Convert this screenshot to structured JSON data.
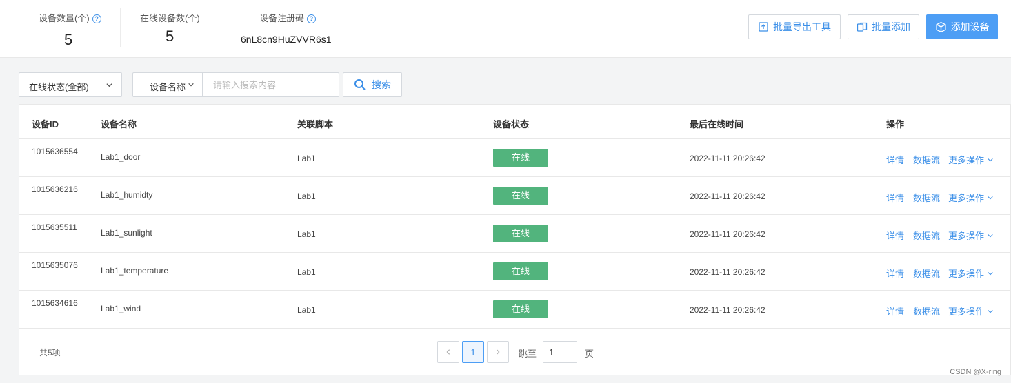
{
  "stats": {
    "device_count": {
      "label": "设备数量(个)",
      "value": "5"
    },
    "online_count": {
      "label": "在线设备数(个)",
      "value": "5"
    },
    "reg_code": {
      "label": "设备注册码",
      "value": "6nL8cn9HuZVVR6s1"
    }
  },
  "toolbar": {
    "export_label": "批量导出工具",
    "batch_add_label": "批量添加",
    "add_label": "添加设备"
  },
  "filters": {
    "status_select": "在线状态(全部)",
    "field_select": "设备名称",
    "search_placeholder": "请输入搜索内容",
    "search_label": "搜索"
  },
  "table": {
    "columns": [
      "设备ID",
      "设备名称",
      "关联脚本",
      "设备状态",
      "最后在线时间",
      "操作"
    ],
    "rows": [
      {
        "id": "1015636554",
        "name": "Lab1_door",
        "script": "Lab1",
        "status": "在线",
        "time": "2022-11-11 20:26:42"
      },
      {
        "id": "1015636216",
        "name": "Lab1_humidty",
        "script": "Lab1",
        "status": "在线",
        "time": "2022-11-11 20:26:42"
      },
      {
        "id": "1015635511",
        "name": "Lab1_sunlight",
        "script": "Lab1",
        "status": "在线",
        "time": "2022-11-11 20:26:42"
      },
      {
        "id": "1015635076",
        "name": "Lab1_temperature",
        "script": "Lab1",
        "status": "在线",
        "time": "2022-11-11 20:26:42"
      },
      {
        "id": "1015634616",
        "name": "Lab1_wind",
        "script": "Lab1",
        "status": "在线",
        "time": "2022-11-11 20:26:42"
      }
    ],
    "actions": {
      "detail": "详情",
      "stream": "数据流",
      "more": "更多操作"
    }
  },
  "pagination": {
    "total": "共5项",
    "current_page": "1",
    "jump_label": "跳至",
    "jump_value": "1",
    "page_suffix": "页"
  },
  "watermark": "CSDN @X-ring",
  "colors": {
    "accent": "#3b8fe8",
    "primary_button": "#4d9ef5",
    "online": "#52b47d"
  },
  "icons": {
    "help": "question-circle-icon",
    "export": "export-icon",
    "batch_add": "batch-add-icon",
    "add_device": "cube-icon",
    "search": "search-icon",
    "dropdown": "chevron-down-icon",
    "prev": "chevron-left-icon",
    "next": "chevron-right-icon"
  }
}
